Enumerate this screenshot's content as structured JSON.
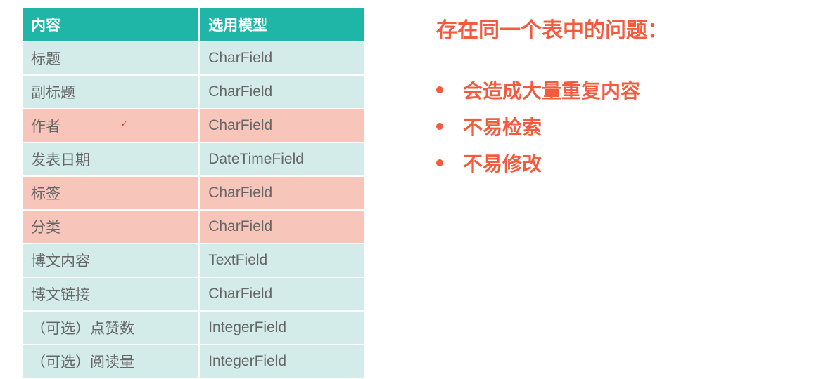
{
  "table": {
    "headers": {
      "col1": "内容",
      "col2": "选用模型"
    },
    "rows": [
      {
        "c1": "标题",
        "c2": "CharField",
        "style": "teal"
      },
      {
        "c1": "副标题",
        "c2": "CharField",
        "style": "teal"
      },
      {
        "c1": "作者",
        "c2": "CharField",
        "style": "coral",
        "marked": true
      },
      {
        "c1": "发表日期",
        "c2": "DateTimeField",
        "style": "teal"
      },
      {
        "c1": "标签",
        "c2": "CharField",
        "style": "coral"
      },
      {
        "c1": "分类",
        "c2": "CharField",
        "style": "coral"
      },
      {
        "c1": "博文内容",
        "c2": "TextField",
        "style": "teal"
      },
      {
        "c1": "博文链接",
        "c2": "CharField",
        "style": "teal"
      },
      {
        "c1": "（可选）点赞数",
        "c2": "IntegerField",
        "style": "teal"
      },
      {
        "c1": "（可选）阅读量",
        "c2": "IntegerField",
        "style": "teal"
      }
    ]
  },
  "right": {
    "heading": "存在同一个表中的问题：",
    "bullets": [
      "会造成大量重复内容",
      "不易检索",
      "不易修改"
    ]
  }
}
